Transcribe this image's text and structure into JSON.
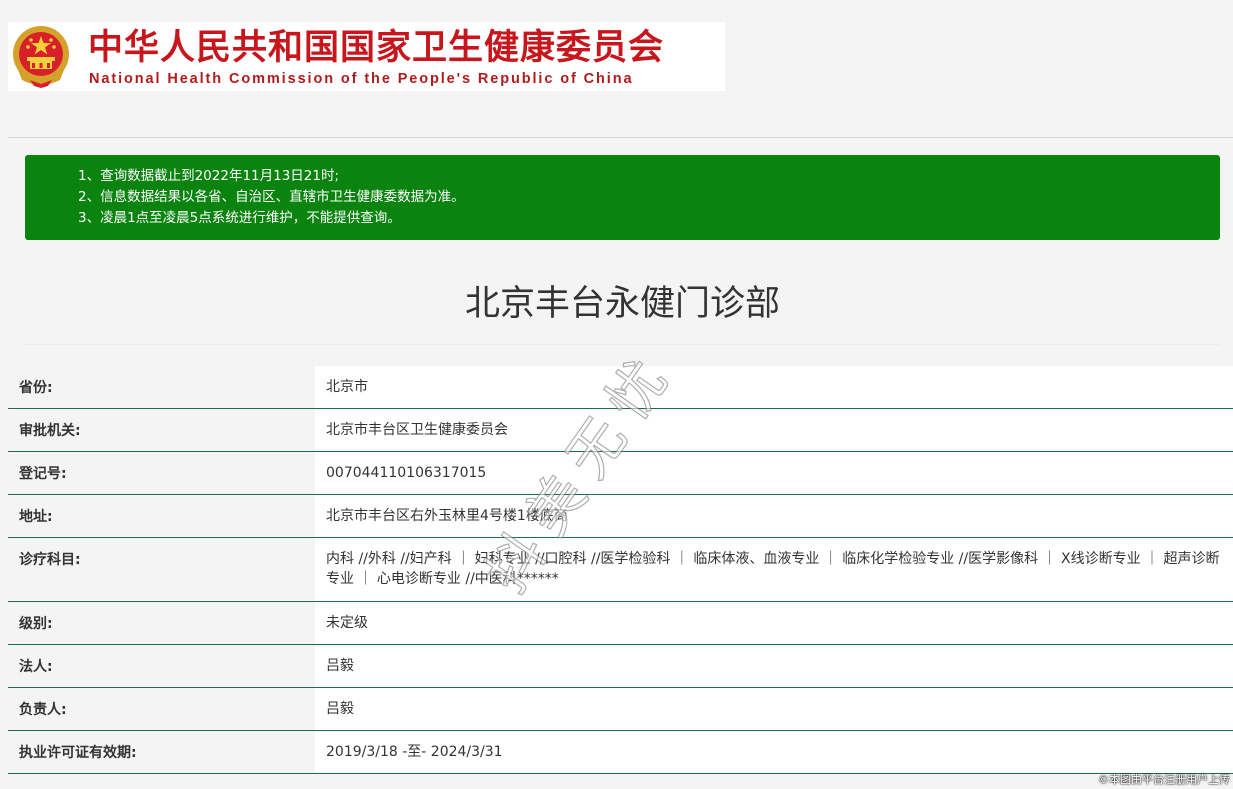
{
  "header": {
    "title_cn": "中华人民共和国国家卫生健康委员会",
    "title_en": "National Health Commission of the People's Republic of China"
  },
  "notice": {
    "lines": [
      "1、查询数据截止到2022年11月13日21时;",
      "2、信息数据结果以各省、自治区、直辖市卫生健康委数据为准。",
      "3、凌晨1点至凌晨5点系统进行维护，不能提供查询。"
    ]
  },
  "page": {
    "title": "北京丰台永健门诊部"
  },
  "info": {
    "rows": [
      {
        "label": "省份:",
        "value": "北京市"
      },
      {
        "label": "审批机关:",
        "value": "北京市丰台区卫生健康委员会"
      },
      {
        "label": "登记号:",
        "value": "007044110106317015"
      },
      {
        "label": "地址:",
        "value": "北京市丰台区右外玉林里4号楼1楼底商"
      },
      {
        "label": "诊疗科目:",
        "value": "内科 //外科 //妇产科 ｜ 妇科专业 //口腔科 //医学检验科 ｜ 临床体液、血液专业 ｜ 临床化学检验专业 //医学影像科 ｜ X线诊断专业 ｜ 超声诊断专业 ｜ 心电诊断专业 //中医科******"
      },
      {
        "label": "级别:",
        "value": "未定级"
      },
      {
        "label": "法人:",
        "value": "吕毅"
      },
      {
        "label": "负责人:",
        "value": "吕毅"
      },
      {
        "label": "执业许可证有效期:",
        "value": "2019/3/18 -至- 2024/3/31"
      }
    ]
  },
  "watermark": "抖美无忧",
  "credit": "©本图由平台注册用户上传",
  "colors": {
    "brand_red": "#c8161d",
    "notice_green": "#0a840f",
    "row_border": "#1d6a56"
  }
}
